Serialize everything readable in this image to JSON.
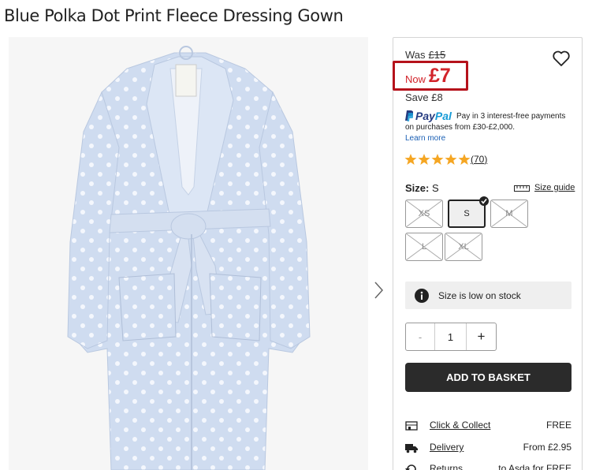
{
  "product": {
    "title": "Blue Polka Dot Print Fleece Dressing Gown"
  },
  "price": {
    "was_label": "Was",
    "was_value": "£15",
    "now_label": "Now",
    "now_value": "£7",
    "save_label": "Save",
    "save_value": "£8",
    "accent_color": "#d2232a"
  },
  "paypal": {
    "logo_pay": "Pay",
    "logo_pal": "Pal",
    "line1": "Pay in 3 interest-free payments",
    "line2": "on purchases from £30-£2,000.",
    "learn_more": "Learn more"
  },
  "rating": {
    "stars": 5,
    "max": 5,
    "count": "70"
  },
  "size": {
    "label": "Size:",
    "selected": "S",
    "guide": "Size guide",
    "options": [
      {
        "label": "XS",
        "available": false
      },
      {
        "label": "S",
        "available": true,
        "selected": true
      },
      {
        "label": "M",
        "available": false
      },
      {
        "label": "L",
        "available": false
      },
      {
        "label": "XL",
        "available": false
      }
    ]
  },
  "stock": {
    "message": "Size is low on stock"
  },
  "quantity": {
    "minus": "-",
    "value": "1",
    "plus": "+"
  },
  "basket": {
    "label": "ADD TO BASKET"
  },
  "delivery": [
    {
      "icon": "store-icon",
      "label": "Click & Collect",
      "value": "FREE"
    },
    {
      "icon": "truck-icon",
      "label": "Delivery",
      "value": "From £2.95"
    },
    {
      "icon": "returns-icon",
      "label": "Returns",
      "value": "to Asda for FREE"
    }
  ]
}
